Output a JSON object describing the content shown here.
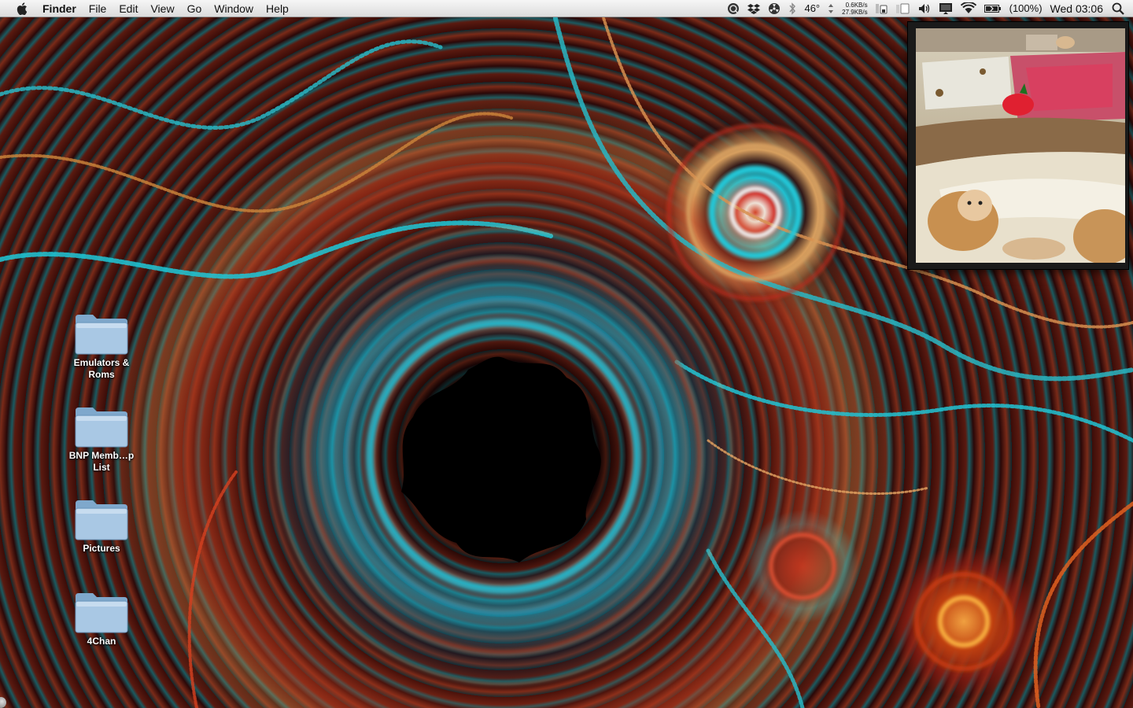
{
  "menubar": {
    "app_name": "Finder",
    "menus": [
      "File",
      "Edit",
      "View",
      "Go",
      "Window",
      "Help"
    ],
    "status": {
      "temperature": "46°",
      "net_up": "0.6KB/s",
      "net_down": "27.9KB/s",
      "battery": "(100%)",
      "clock": "Wed 03:06",
      "icons": [
        "quicksilver-icon",
        "dropbox-icon",
        "radiation-icon",
        "bluetooth-icon",
        "temperature-icon",
        "network-meter-icon",
        "memory-meter-icon",
        "cpu-meter-icon",
        "volume-icon",
        "display-icon",
        "wifi-icon",
        "battery-icon",
        "spotlight-icon"
      ]
    }
  },
  "desktop": {
    "icons": [
      {
        "label": "Emulators & Roms",
        "kind": "folder-icon"
      },
      {
        "label": "BNP Memb…p List",
        "kind": "folder-icon"
      },
      {
        "label": "Pictures",
        "kind": "folder-icon"
      },
      {
        "label": "4Chan",
        "kind": "folder-icon"
      }
    ]
  },
  "colors": {
    "menubar_bg": "#e8e8e8",
    "folder_blue": "#9fc2e0",
    "wallpaper_cyan": "#20c0d0",
    "wallpaper_red": "#c03020"
  }
}
